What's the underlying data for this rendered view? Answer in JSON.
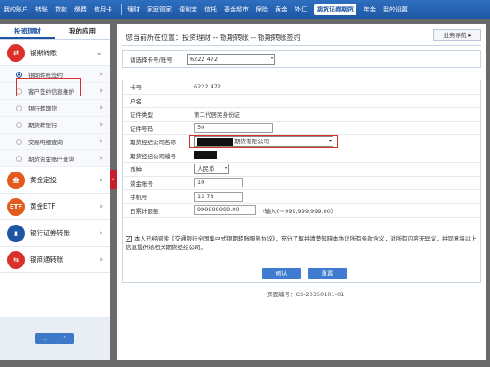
{
  "topnav": {
    "left": [
      "我的账户",
      "转账",
      "贷款",
      "缴费",
      "信用卡"
    ],
    "right": [
      "理财",
      "家庭管家",
      "便利宝",
      "信托",
      "基金超市",
      "保险",
      "黄金",
      "外汇",
      "期货证券期货",
      "年金",
      "我的设置"
    ],
    "active": "期货证券期货"
  },
  "sidebar": {
    "tabs": [
      "投资理财",
      "我的应用"
    ],
    "sections": [
      {
        "label": "银期转账",
        "icon": "futures-transfer-icon",
        "color": "#d9302a"
      },
      {
        "label": "黄金定投",
        "icon": "gold-invest-icon",
        "color": "#e25a1c"
      },
      {
        "label": "黄金ETF",
        "icon": "gold-etf-icon",
        "color": "#e25a1c"
      },
      {
        "label": "银行证券转账",
        "icon": "bank-securities-icon",
        "color": "#1d56a3"
      },
      {
        "label": "银商通转账",
        "icon": "bank-merchant-icon",
        "color": "#d9302a"
      }
    ],
    "subitems": [
      "银期转账签约",
      "客户签约信息维护",
      "银行转期货",
      "期货转银行",
      "交易明细查询",
      "期货资金账户查询"
    ]
  },
  "main": {
    "breadcrumb": "您当前所在位置：投资理财 -- 银期转账 -- 银期转账签约",
    "guide": "业务导航 ▸",
    "select_label": "请选择卡号/账号",
    "select_value": "6222              472",
    "rows": {
      "card_no_label": "卡号",
      "card_no": "6222                    472",
      "name_label": "户名",
      "id_type_label": "证件类型",
      "id_type": "第二代居民身份证",
      "id_no_label": "证件号码",
      "id_no": "50",
      "company_label": "期货经纪公司名称",
      "company": "期货有限公司",
      "company_no_label": "期货经纪公司编号",
      "currency_label": "币种",
      "currency": "人民币",
      "fund_acct_label": "资金账号",
      "fund_acct": "10",
      "phone_label": "手机号",
      "phone": "13          78",
      "limit_label": "日累计限额",
      "limit": "999999999.00",
      "limit_hint": "（输入0~999,999,999.00）"
    },
    "agree_text": "本人已经阅读《交通银行全国集中式银期转账服务协议》，充分了解并清楚知晓本协议所有条款含义，对所有内容无异议，并同意将以上信息提供给相关期货经纪公司。",
    "confirm": "确认",
    "reset": "重置",
    "page_no": "页面编号：CS-20350101-01"
  }
}
